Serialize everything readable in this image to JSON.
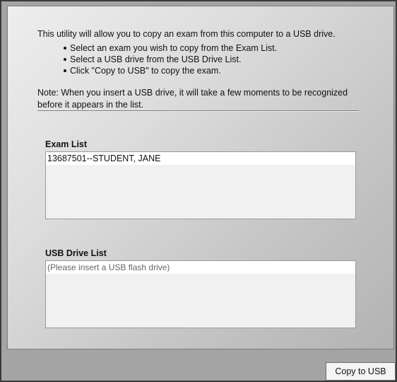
{
  "intro_text": "This utility will allow you to copy an exam from this computer to a USB drive.",
  "instructions": [
    "Select an exam you wish to copy from the Exam List.",
    "Select a USB drive from the USB Drive List.",
    "Click \"Copy to USB\" to copy the exam."
  ],
  "note_text": "Note:  When you insert a USB drive, it will take a few moments to be recognized before it appears in the list.",
  "exam_list": {
    "label": "Exam List",
    "items": [
      "13687501--STUDENT, JANE"
    ]
  },
  "usb_list": {
    "label": "USB Drive List",
    "placeholder_item": "(Please insert a USB flash drive)"
  },
  "copy_button_label": "Copy to USB"
}
